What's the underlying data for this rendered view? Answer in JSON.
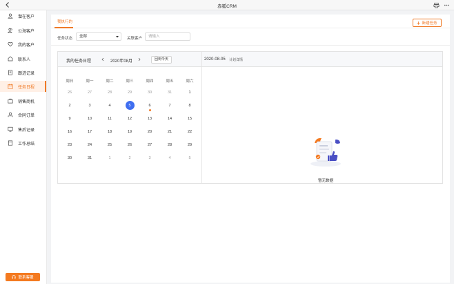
{
  "window": {
    "title": "赤狐CRM"
  },
  "sidebar": {
    "items": [
      {
        "label": "潜在客户",
        "icon": "person-icon"
      },
      {
        "label": "公海客户",
        "icon": "person-group-icon"
      },
      {
        "label": "我的客户",
        "icon": "heart-icon"
      },
      {
        "label": "联系人",
        "icon": "contact-icon"
      },
      {
        "label": "跟进记录",
        "icon": "record-icon"
      },
      {
        "label": "任务日程",
        "icon": "calendar-icon",
        "active": true
      },
      {
        "label": "销售商机",
        "icon": "briefcase-icon"
      },
      {
        "label": "合同订单",
        "icon": "contract-icon"
      },
      {
        "label": "售后记录",
        "icon": "aftersale-icon"
      },
      {
        "label": "工作总结",
        "icon": "summary-icon"
      }
    ],
    "service_label": "联系客服"
  },
  "main": {
    "tab_label": "我执行的",
    "new_task_label": "新建任务",
    "filters": {
      "status_label": "任务状态",
      "status_value": "全部",
      "customer_label": "关联客户",
      "customer_placeholder": "请输入"
    },
    "calendar": {
      "title": "我的任务日程",
      "month": "2020年08月",
      "today_label": "回到今天",
      "weekdays": [
        "周日",
        "周一",
        "周二",
        "周三",
        "周四",
        "周五",
        "周六"
      ],
      "weeks": [
        [
          "26",
          "27",
          "28",
          "29",
          "30",
          "31",
          "1"
        ],
        [
          "2",
          "3",
          "4",
          "5",
          "6",
          "7",
          "8"
        ],
        [
          "9",
          "10",
          "11",
          "12",
          "13",
          "14",
          "15"
        ],
        [
          "16",
          "17",
          "18",
          "19",
          "20",
          "21",
          "22"
        ],
        [
          "23",
          "24",
          "25",
          "26",
          "27",
          "28",
          "29"
        ],
        [
          "30",
          "31",
          "1",
          "2",
          "3",
          "4",
          "5"
        ]
      ],
      "selected_date": "5",
      "detail_date": "2020-08-05",
      "detail_label": "计划详情",
      "empty_text": "暂无数据"
    }
  },
  "colors": {
    "accent": "#f07a27",
    "selected": "#3f6ef0"
  }
}
